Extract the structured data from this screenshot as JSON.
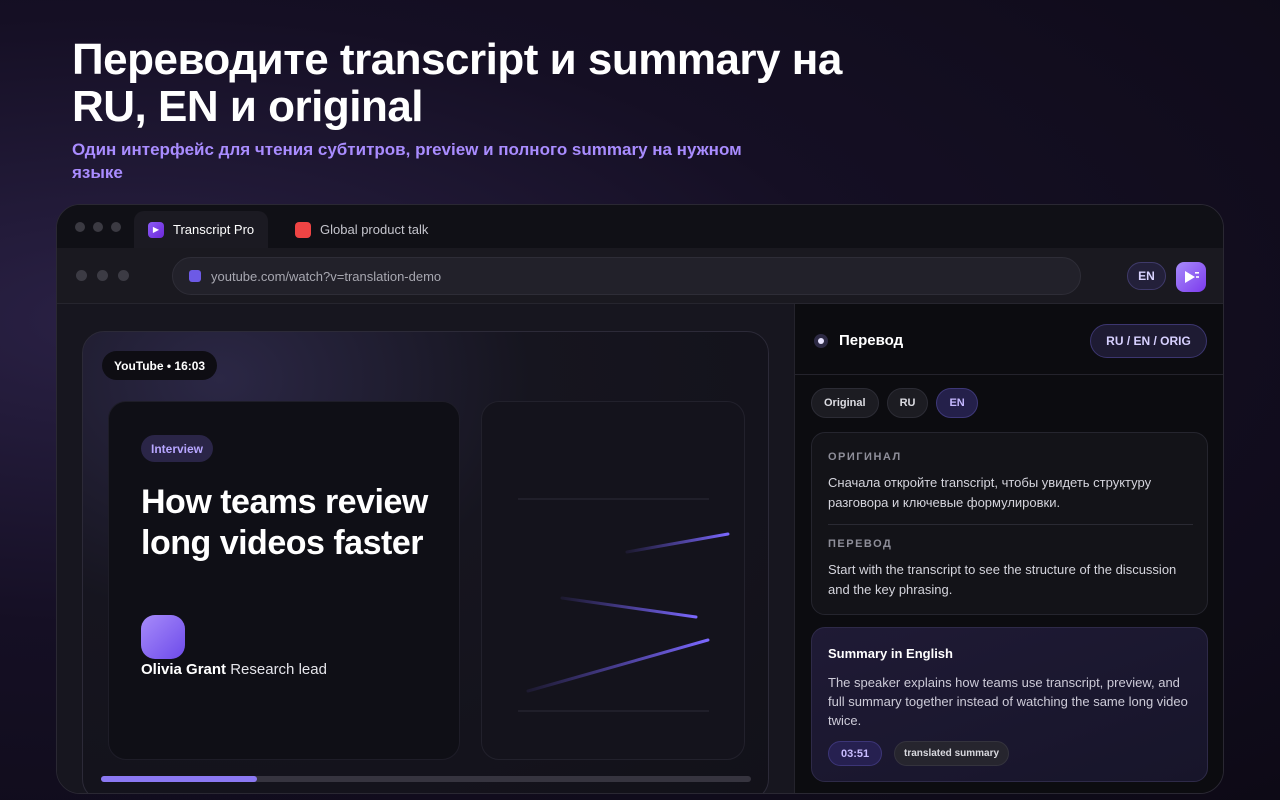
{
  "hero": {
    "title": "Переводите transcript и summary на RU, EN и original",
    "subtitle": "Один интерфейс для чтения субтитров, preview и полного summary на нужном языке"
  },
  "browser": {
    "tabs": [
      {
        "label": "Transcript Pro",
        "active": true
      },
      {
        "label": "Global product talk",
        "active": false
      }
    ],
    "url": "youtube.com/watch?v=translation-demo",
    "lang_button": "EN"
  },
  "video": {
    "badge": "YouTube • 16:03",
    "tag": "Interview",
    "title": "How teams review long videos faster",
    "speaker_name": "Olivia Grant",
    "speaker_role": "Research lead",
    "progress": 0.24
  },
  "panel": {
    "title": "Перевод",
    "mode_button": "RU / EN / ORIG",
    "chips": [
      {
        "label": "Original",
        "active": false
      },
      {
        "label": "RU",
        "active": false
      },
      {
        "label": "EN",
        "active": true
      }
    ],
    "original_label": "ОРИГИНАЛ",
    "original_text": "Сначала откройте transcript, чтобы увидеть структуру разговора и ключевые формулировки.",
    "translation_label": "ПЕРЕВОД",
    "translation_text": "Start with the transcript to see the structure of the discussion and the key phrasing.",
    "summary_title": "Summary in English",
    "summary_text": "The speaker explains how teams use transcript, preview, and full summary together instead of watching the same long video twice.",
    "summary_time": "03:51",
    "summary_tag": "translated summary"
  },
  "colors": {
    "accent": "#8b5cf6",
    "accent_light": "#a98cff"
  }
}
